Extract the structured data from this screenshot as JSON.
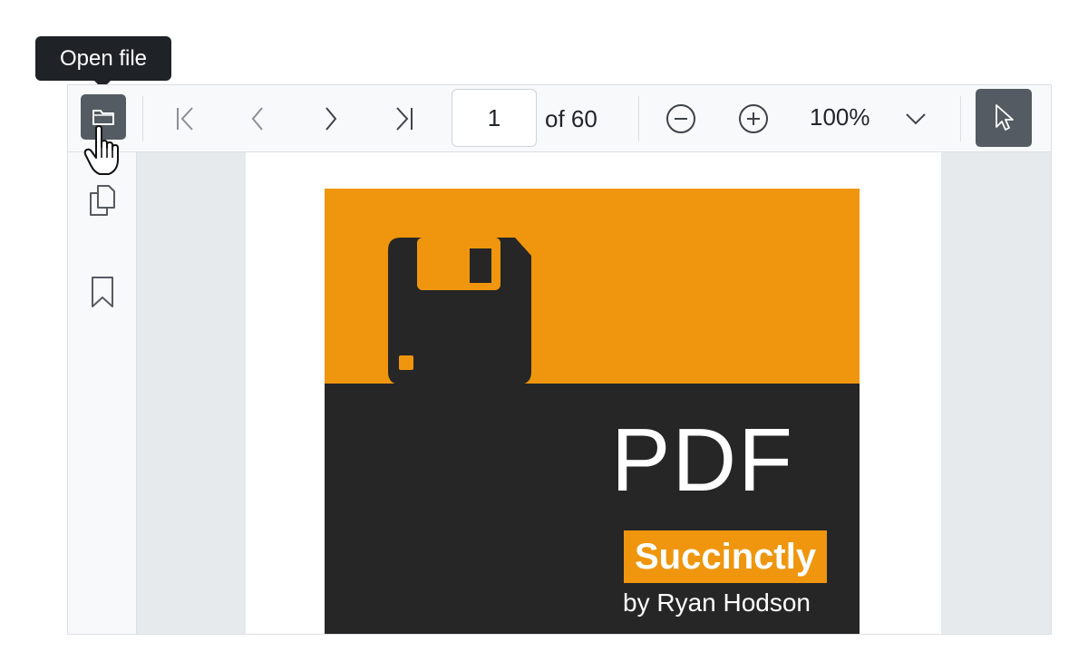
{
  "tooltip": {
    "text": "Open file"
  },
  "toolbar": {
    "open_file_icon": "folder-icon",
    "first_page_icon": "first-page-icon",
    "prev_page_icon": "chevron-left-icon",
    "next_page_icon": "chevron-right-icon",
    "last_page_icon": "last-page-icon",
    "current_page": "1",
    "total_pages_label": "of 60",
    "zoom_out_icon": "zoom-out-icon",
    "zoom_in_icon": "zoom-in-icon",
    "zoom_level": "100%",
    "zoom_dropdown_icon": "chevron-down-icon",
    "text_select_icon": "pointer-icon"
  },
  "sidebar": {
    "items": [
      {
        "icon": "copy-pages-icon"
      },
      {
        "icon": "bookmark-icon"
      }
    ]
  },
  "document": {
    "cover_title": "PDF",
    "cover_badge": "Succinctly",
    "cover_author": "by Ryan Hodson",
    "cover_icon": "floppy-disk-icon"
  },
  "colors": {
    "accent_orange": "#ef960e",
    "cover_dark": "#262626",
    "button_active": "#545b62",
    "toolbar_bg": "#f8f9fa",
    "canvas_bg": "#e7eaed"
  }
}
